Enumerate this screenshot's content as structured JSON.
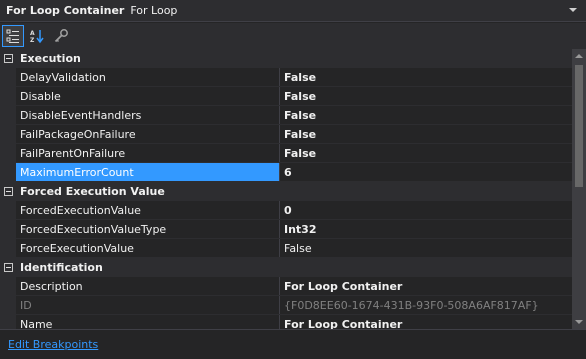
{
  "header": {
    "object_name": "For Loop Container",
    "object_type": "For Loop"
  },
  "toolbar": {
    "buttons": [
      {
        "icon": "categorized-icon",
        "active": true
      },
      {
        "icon": "alphabetical-sort-icon",
        "active": false
      },
      {
        "icon": "property-pages-icon",
        "active": false
      }
    ]
  },
  "categories": {
    "execution": {
      "label": "Execution",
      "props": [
        {
          "name": "DelayValidation",
          "value": "False"
        },
        {
          "name": "Disable",
          "value": "False"
        },
        {
          "name": "DisableEventHandlers",
          "value": "False"
        },
        {
          "name": "FailPackageOnFailure",
          "value": "False"
        },
        {
          "name": "FailParentOnFailure",
          "value": "False"
        },
        {
          "name": "MaximumErrorCount",
          "value": "6"
        }
      ]
    },
    "forced": {
      "label": "Forced Execution Value",
      "props": [
        {
          "name": "ForcedExecutionValue",
          "value": "0"
        },
        {
          "name": "ForcedExecutionValueType",
          "value": "Int32"
        },
        {
          "name": "ForceExecutionValue",
          "value": "False"
        }
      ]
    },
    "identification": {
      "label": "Identification",
      "props": [
        {
          "name": "Description",
          "value": "For Loop Container"
        },
        {
          "name": "ID",
          "value": "{F0D8EE60-1674-431B-93F0-508A6AF817AF}"
        },
        {
          "name": "Name",
          "value": "For Loop Container"
        }
      ]
    }
  },
  "commands": {
    "edit_breakpoints": "Edit Breakpoints"
  },
  "colors": {
    "background": "#252526",
    "selection": "#3399ff",
    "link": "#3399ff",
    "category": "#2d2d30"
  }
}
